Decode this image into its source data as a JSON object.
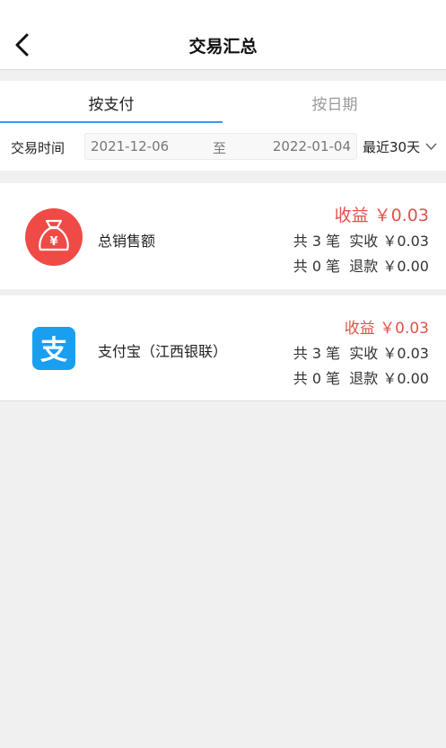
{
  "header": {
    "title": "交易汇总",
    "back_icon": "chevron-left-icon"
  },
  "tabs": [
    {
      "label": "按支付",
      "active": true
    },
    {
      "label": "按日期",
      "active": false
    }
  ],
  "filter": {
    "label": "交易时间",
    "start_date": "2021-12-06",
    "separator": "至",
    "end_date": "2022-01-04",
    "range": "最近30天",
    "range_icon": "chevron-down-icon"
  },
  "colors": {
    "accent": "#3a95f0",
    "profit": "#e0534b",
    "sales_icon": "#f04a47",
    "alipay": "#1a9ff0"
  },
  "cards": [
    {
      "icon": "money-bag-icon",
      "name": "总销售额",
      "profit": "收益 ￥0.03",
      "line1": "共 3 笔  实收 ￥0.03",
      "line2": "共 0 笔  退款 ￥0.00"
    },
    {
      "icon": "alipay-icon",
      "name": "支付宝（江西银联）",
      "profit": "收益 ￥0.03",
      "line1": "共 3 笔  实收 ￥0.03",
      "line2": "共 0 笔  退款 ￥0.00"
    }
  ]
}
